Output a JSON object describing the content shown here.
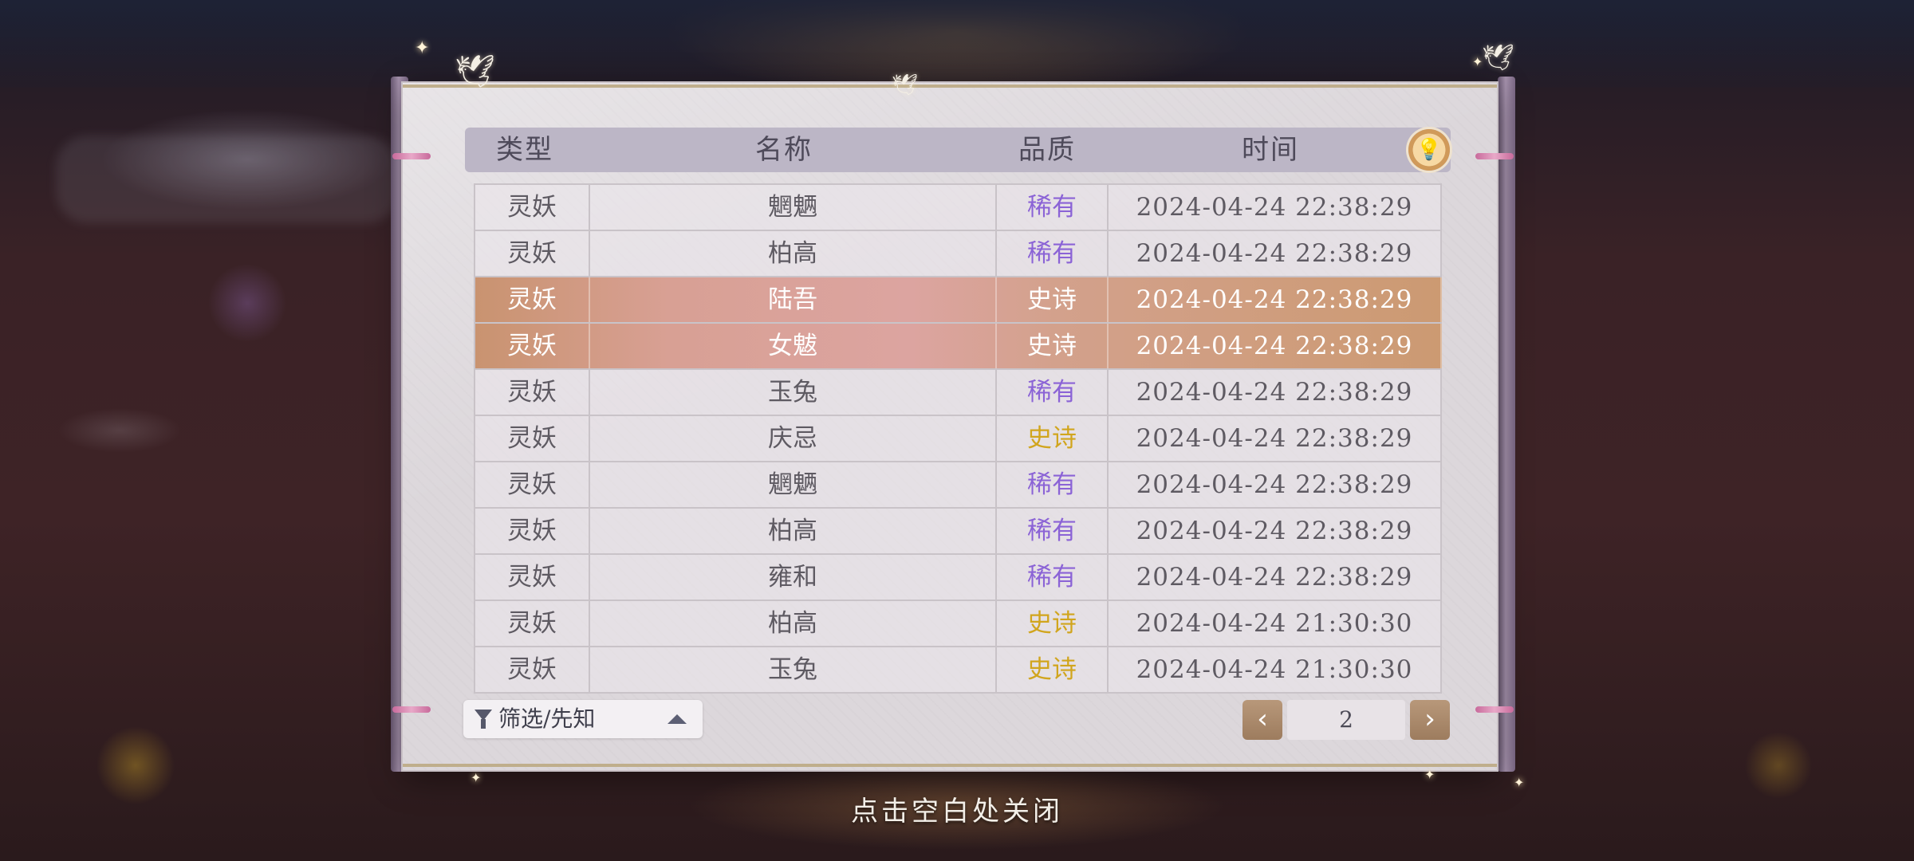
{
  "table": {
    "headers": {
      "type": "类型",
      "name": "名称",
      "quality": "品质",
      "time": "时间"
    },
    "rows": [
      {
        "type": "灵妖",
        "name": "魍魉",
        "quality": "稀有",
        "time": "2024-04-24  22:38:29"
      },
      {
        "type": "灵妖",
        "name": "柏高",
        "quality": "稀有",
        "time": "2024-04-24  22:38:29"
      },
      {
        "type": "灵妖",
        "name": "陆吾",
        "quality": "史诗",
        "time": "2024-04-24  22:38:29"
      },
      {
        "type": "灵妖",
        "name": "女魃",
        "quality": "史诗",
        "time": "2024-04-24  22:38:29"
      },
      {
        "type": "灵妖",
        "name": "玉兔",
        "quality": "稀有",
        "time": "2024-04-24  22:38:29"
      },
      {
        "type": "灵妖",
        "name": "庆忌",
        "quality": "史诗",
        "time": "2024-04-24  22:38:29"
      },
      {
        "type": "灵妖",
        "name": "魍魉",
        "quality": "稀有",
        "time": "2024-04-24  22:38:29"
      },
      {
        "type": "灵妖",
        "name": "柏高",
        "quality": "稀有",
        "time": "2024-04-24  22:38:29"
      },
      {
        "type": "灵妖",
        "name": "雍和",
        "quality": "稀有",
        "time": "2024-04-24  22:38:29"
      },
      {
        "type": "灵妖",
        "name": "柏高",
        "quality": "史诗",
        "time": "2024-04-24  21:30:30"
      },
      {
        "type": "灵妖",
        "name": "玉兔",
        "quality": "史诗",
        "time": "2024-04-24  21:30:30"
      }
    ]
  },
  "tip_icon": "lightbulb-icon",
  "filter": {
    "label": "筛选/先知",
    "icon": "filter-icon",
    "caret": "caret-up-icon"
  },
  "pagination": {
    "current_page": "2",
    "prev_icon": "chevron-left-icon",
    "next_icon": "chevron-right-icon"
  },
  "close_hint": "点击空白处关闭",
  "colors": {
    "rare": "#8b63d6",
    "epic": "#d1a51d",
    "highlight_row": "#d8a094",
    "accent_button": "#a88566"
  }
}
